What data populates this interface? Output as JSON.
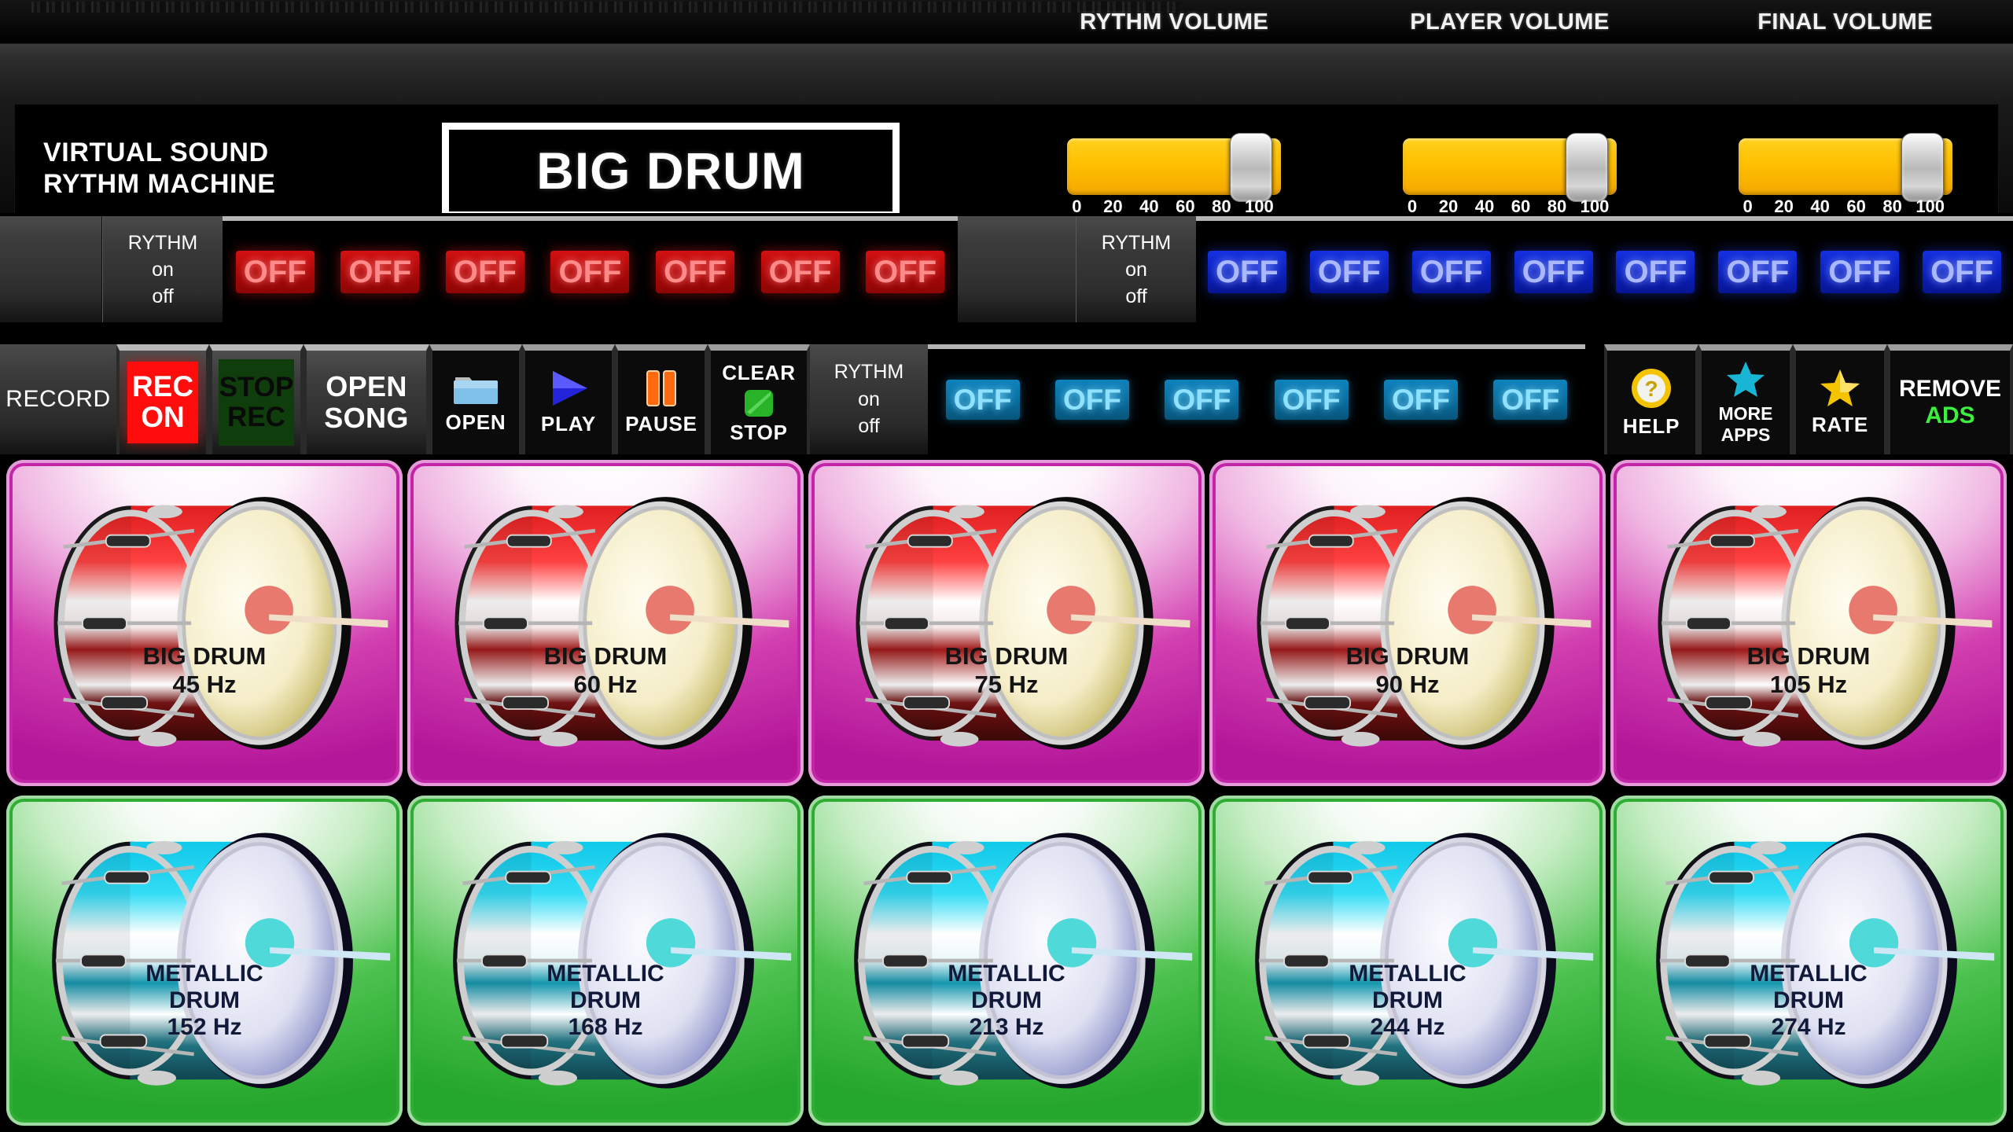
{
  "header": {
    "brand_line1": "VIRTUAL SOUND",
    "brand_line2": "RYTHM MACHINE",
    "logo": "BIG DRUM"
  },
  "volumes": {
    "scale_ticks": [
      "0",
      "20",
      "40",
      "60",
      "80",
      "100"
    ],
    "sliders": [
      {
        "label": "RYTHM VOLUME",
        "value": 100
      },
      {
        "label": "PLAYER VOLUME",
        "value": 100
      },
      {
        "label": "FINAL VOLUME",
        "value": 100
      }
    ]
  },
  "rythm_row": {
    "toggle_title": "RYTHM",
    "toggle_on": "on",
    "toggle_off": "off",
    "red_steps": [
      "OFF",
      "OFF",
      "OFF",
      "OFF",
      "OFF",
      "OFF",
      "OFF"
    ],
    "blue_steps": [
      "OFF",
      "OFF",
      "OFF",
      "OFF",
      "OFF",
      "OFF",
      "OFF",
      "OFF"
    ]
  },
  "control_row": {
    "record_label": "RECORD",
    "rec_on": {
      "line1": "REC",
      "line2": "ON"
    },
    "stop_rec": {
      "line1": "STOP",
      "line2": "REC"
    },
    "open_song": {
      "line1": "OPEN",
      "line2": "SONG"
    },
    "open": {
      "label": "OPEN",
      "icon": "folder-icon"
    },
    "play": {
      "label": "PLAY",
      "icon": "play-triangle-icon"
    },
    "pause": {
      "label": "PAUSE",
      "icon": "pause-bars-icon"
    },
    "clear_stop": {
      "line1": "CLEAR",
      "line2": "STOP",
      "icon": "stop-square-icon"
    },
    "rythm_toggle": {
      "title": "RYTHM",
      "on": "on",
      "off": "off"
    },
    "cyan_steps": [
      "OFF",
      "OFF",
      "OFF",
      "OFF",
      "OFF",
      "OFF"
    ],
    "help": {
      "label": "HELP",
      "icon": "question-circle-icon"
    },
    "more_apps": {
      "line1": "MORE",
      "line2": "APPS",
      "icon": "star-cyan-icon"
    },
    "rate": {
      "label": "RATE",
      "icon": "star-gold-icon"
    },
    "remove_ads": {
      "line1": "REMOVE",
      "line2": "ADS",
      "icon": "remove-ads-icon"
    }
  },
  "pads_row1": [
    {
      "name": "BIG DRUM",
      "freq": "45 Hz"
    },
    {
      "name": "BIG DRUM",
      "freq": "60 Hz"
    },
    {
      "name": "BIG DRUM",
      "freq": "75 Hz"
    },
    {
      "name": "BIG DRUM",
      "freq": "90 Hz"
    },
    {
      "name": "BIG DRUM",
      "freq": "105 Hz"
    }
  ],
  "pads_row2": [
    {
      "line1": "METALLIC",
      "line2": "DRUM",
      "freq": "152 Hz"
    },
    {
      "line1": "METALLIC",
      "line2": "DRUM",
      "freq": "168 Hz"
    },
    {
      "line1": "METALLIC",
      "line2": "DRUM",
      "freq": "213 Hz"
    },
    {
      "line1": "METALLIC",
      "line2": "DRUM",
      "freq": "244 Hz"
    },
    {
      "line1": "METALLIC",
      "line2": "DRUM",
      "freq": "274 Hz"
    }
  ],
  "colors": {
    "slider_fill": "#ffc000",
    "rec_on": "#ff0d0d",
    "stop_rec": "#0f3d0c",
    "off_red": "#d41111",
    "off_blue": "#1430e0",
    "off_cyan": "#0f82bc",
    "pad_magenta": "#c225a8",
    "pad_green": "#2fae33",
    "remove_ads_accent": "#3ef03e",
    "help_accent": "#f5c400",
    "more_apps_accent": "#18b6d4",
    "rate_accent": "#f5c400"
  }
}
